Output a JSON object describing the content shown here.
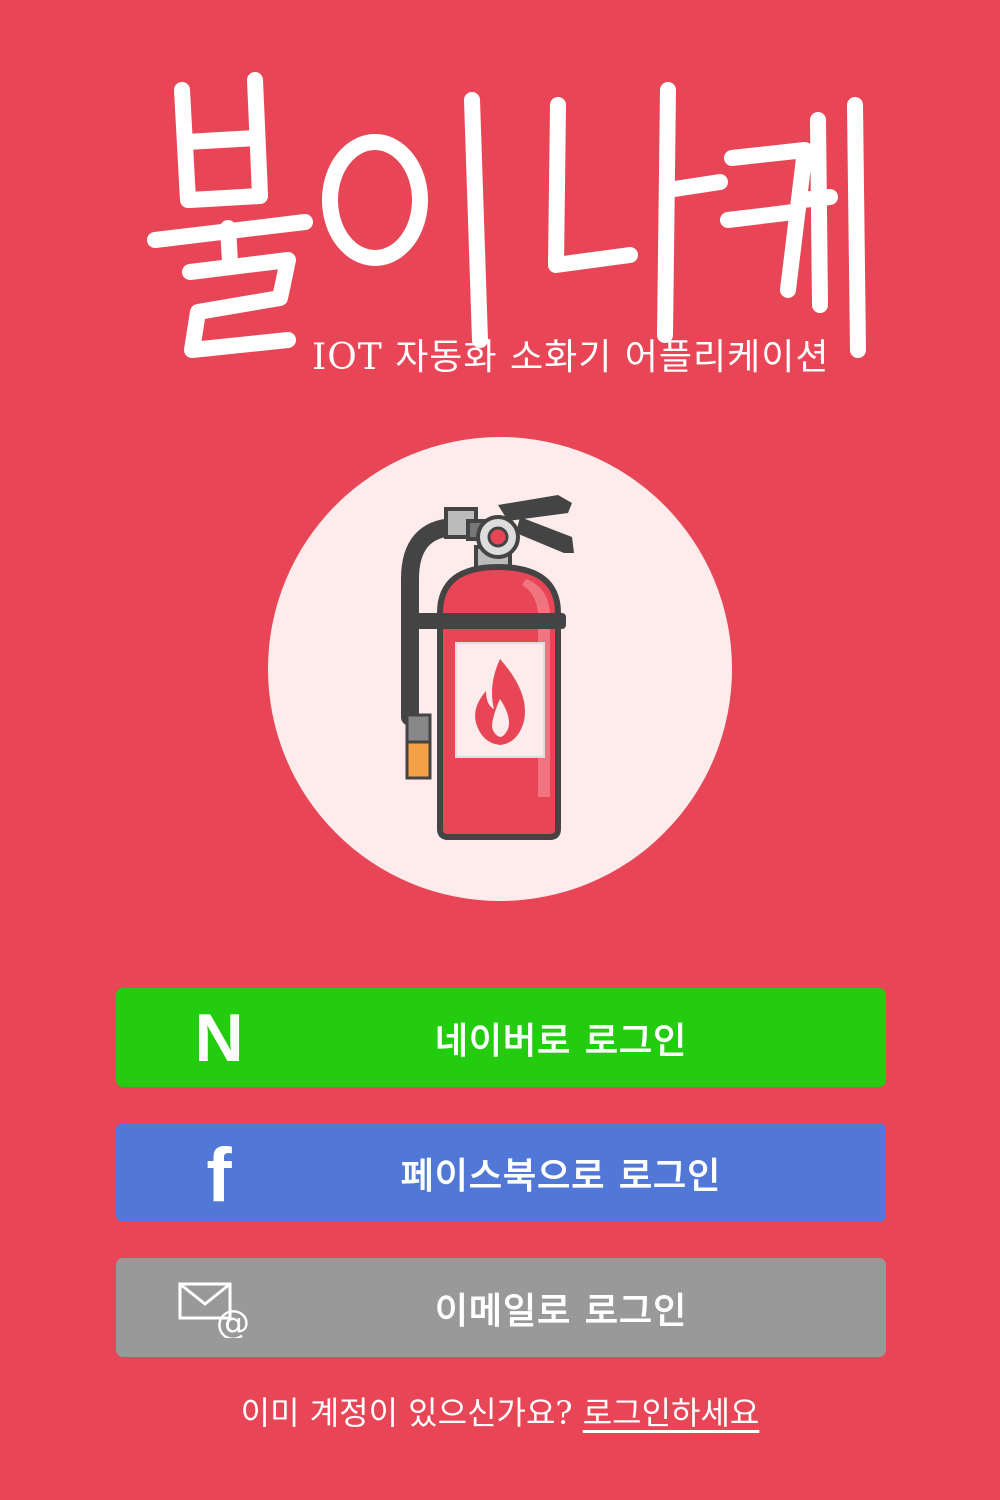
{
  "app": {
    "title": "불이나케",
    "subtitle": "IOT 자동화 소화기 어플리케이션"
  },
  "hero": {
    "icon": "fire-extinguisher-icon"
  },
  "login": {
    "naver": {
      "icon": "naver-n-icon",
      "icon_text": "N",
      "label": "네이버로 로그인",
      "color": "#24cc10"
    },
    "facebook": {
      "icon": "facebook-f-icon",
      "icon_text": "f",
      "label": "페이스북으로 로그인",
      "color": "#5178d6"
    },
    "email": {
      "icon": "mail-at-icon",
      "label": "이메일로 로그인",
      "color": "#999999"
    }
  },
  "footer": {
    "question": "이미 계정이 있으신가요?",
    "link": "로그인하세요"
  },
  "colors": {
    "background": "#e84656",
    "circle": "#fdeceb",
    "extinguisher_red": "#e84656"
  }
}
